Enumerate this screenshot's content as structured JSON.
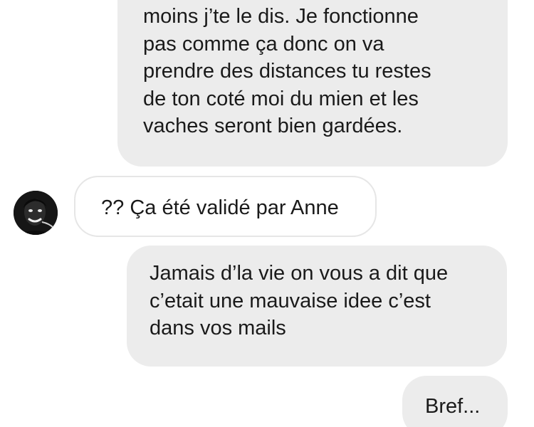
{
  "conversation": {
    "messages": [
      {
        "direction": "sent",
        "lines": [
          "moins j’te le dis. Je fonctionne",
          "pas comme ça donc on va",
          "prendre des distances tu restes",
          "de ton coté moi du mien et les",
          "vaches seront bien gardées."
        ]
      },
      {
        "direction": "received",
        "text": "?? Ça été validé par Anne"
      },
      {
        "direction": "sent",
        "lines": [
          "Jamais d’la vie on vous a dit que",
          "c’etait une mauvaise idee c’est",
          "dans vos mails"
        ]
      },
      {
        "direction": "sent",
        "text": "Bref..."
      }
    ],
    "avatar_icon": "person-avatar-icon"
  },
  "colors": {
    "sent_bubble": "#ececec",
    "received_border": "#e6e6e6",
    "text": "#1a1a1a"
  }
}
